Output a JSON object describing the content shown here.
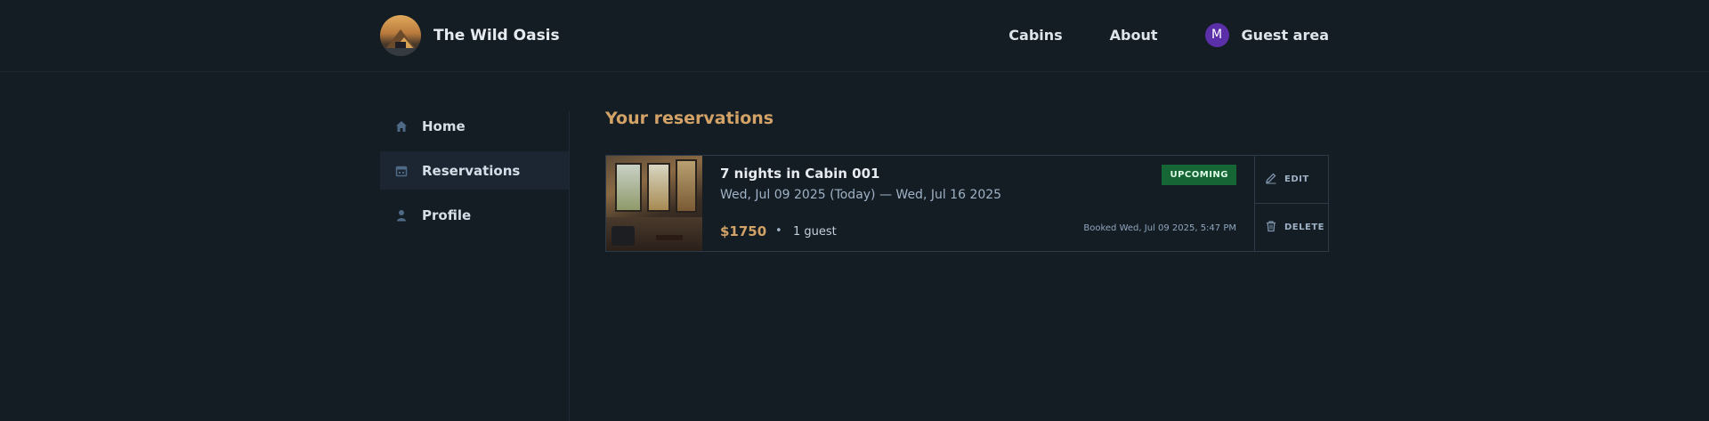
{
  "header": {
    "brand": "The Wild Oasis",
    "nav": [
      {
        "label": "Cabins"
      },
      {
        "label": "About"
      }
    ],
    "guest": {
      "avatar_initial": "M",
      "label": "Guest area"
    }
  },
  "sidebar": {
    "items": [
      {
        "label": "Home",
        "icon": "home-icon",
        "active": false
      },
      {
        "label": "Reservations",
        "icon": "calendar-icon",
        "active": true
      },
      {
        "label": "Profile",
        "icon": "user-icon",
        "active": false
      }
    ]
  },
  "main": {
    "title": "Your reservations",
    "reservation": {
      "title": "7 nights in Cabin 001",
      "dates": "Wed, Jul 09 2025 (Today) — Wed, Jul 16 2025",
      "price": "$1750",
      "separator": "•",
      "guests": "1 guest",
      "status": "UPCOMING",
      "booked": "Booked Wed, Jul 09 2025, 5:47 PM",
      "edit_label": "EDIT",
      "delete_label": "DELETE"
    }
  },
  "colors": {
    "background": "#141c24",
    "accent": "#d2a266",
    "badge_bg": "#166534",
    "avatar_bg": "#5b2fa8"
  }
}
